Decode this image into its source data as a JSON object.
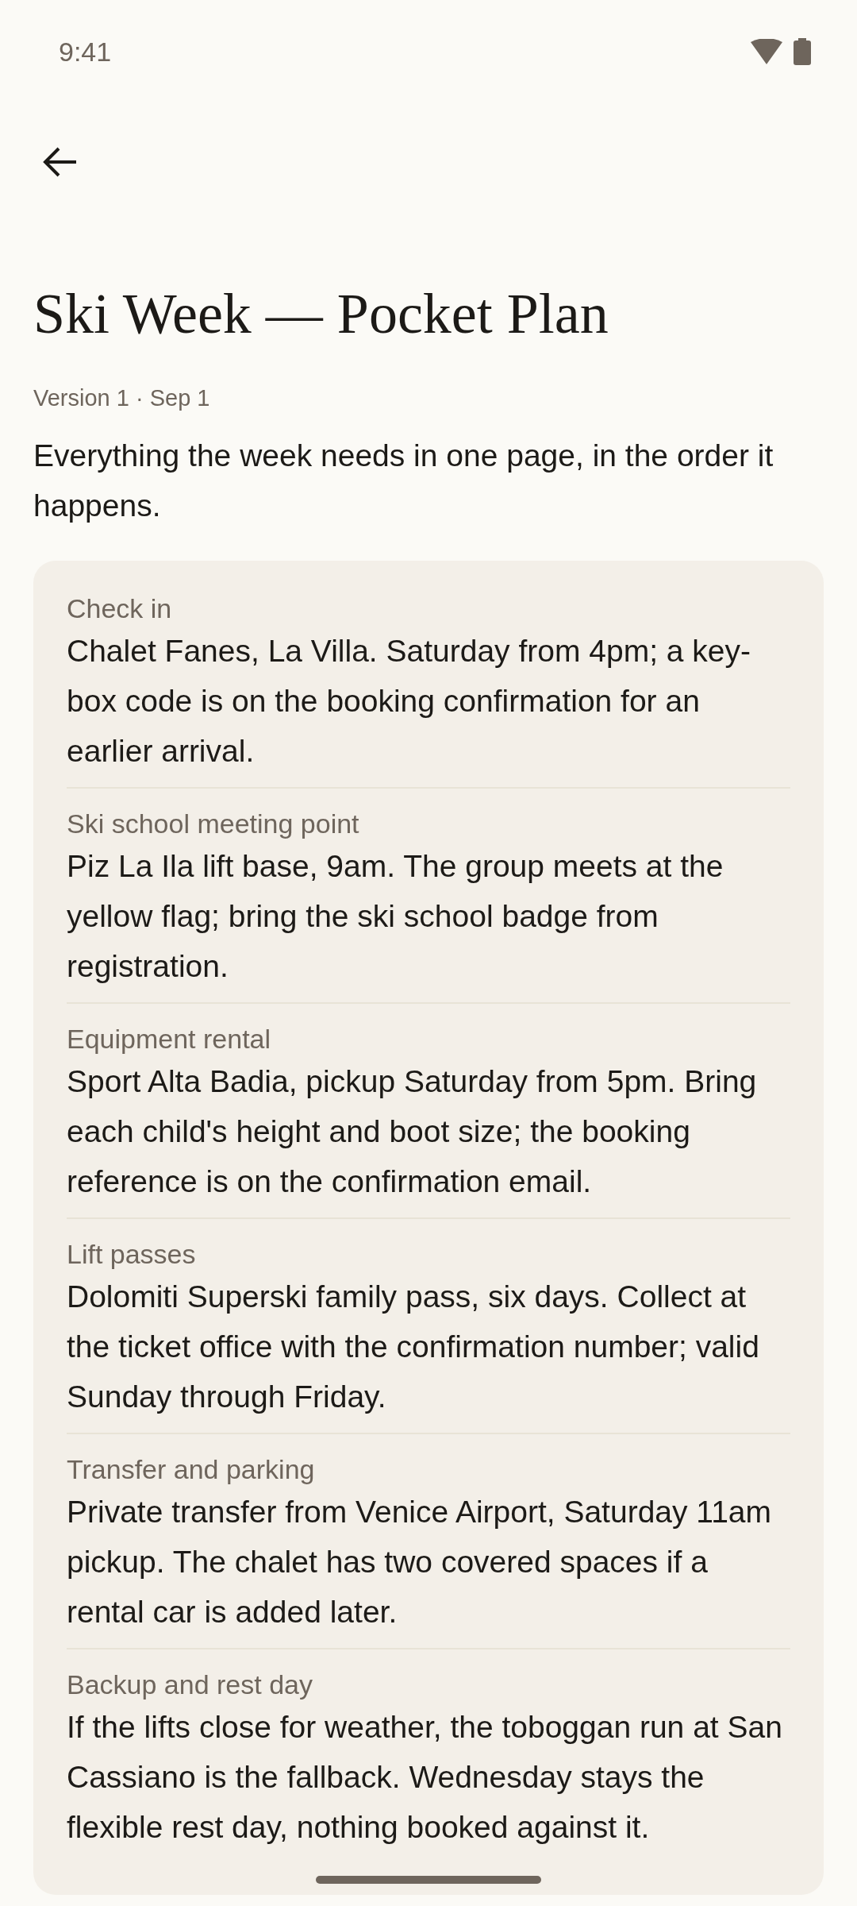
{
  "status_bar": {
    "time": "9:41"
  },
  "title": "Ski Week — Pocket Plan",
  "meta": "Version 1 · Sep 1",
  "intro": "Everything the week needs in one page, in the order it happens.",
  "sections": [
    {
      "label": "Check in",
      "text": "Chalet Fanes, La Villa. Saturday from 4pm; a key-box code is on the booking confirmation for an earlier arrival."
    },
    {
      "label": "Ski school meeting point",
      "text": "Piz La Ila lift base, 9am. The group meets at the yellow flag; bring the ski school badge from registration."
    },
    {
      "label": "Equipment rental",
      "text": "Sport Alta Badia, pickup Saturday from 5pm. Bring each child's height and boot size; the booking reference is on the confirmation email."
    },
    {
      "label": "Lift passes",
      "text": "Dolomiti Superski family pass, six days. Collect at the ticket office with the confirmation number; valid Sunday through Friday."
    },
    {
      "label": "Transfer and parking",
      "text": "Private transfer from Venice Airport, Saturday 11am pickup. The chalet has two covered spaces if a rental car is added later."
    },
    {
      "label": "Backup and rest day",
      "text": "If the lifts close for weather, the toboggan run at San Cassiano is the fallback. Wednesday stays the flexible rest day, nothing booked against it."
    }
  ]
}
